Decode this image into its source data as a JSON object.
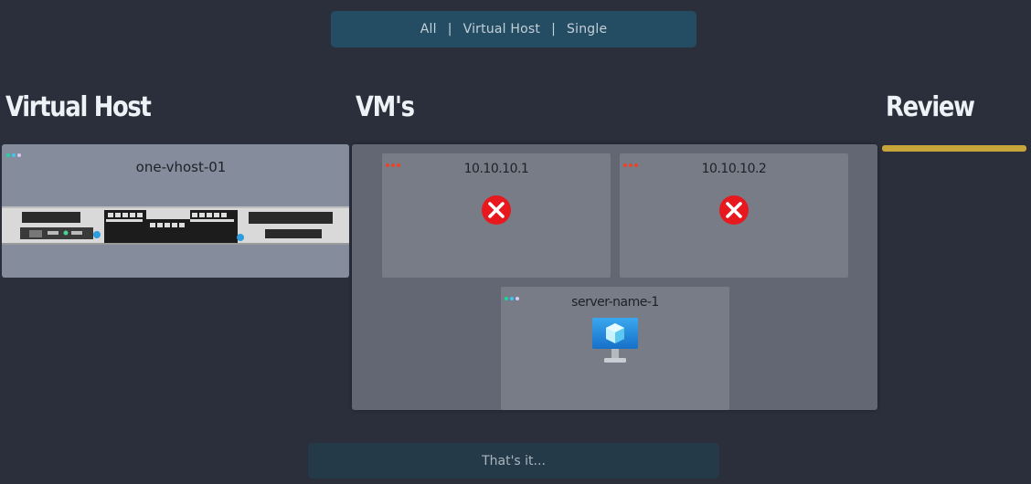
{
  "filter": {
    "options": [
      "All",
      "Virtual Host",
      "Single"
    ],
    "separator": "|"
  },
  "sections": {
    "virtual_host": "Virtual Host",
    "vms": "VM's",
    "review": "Review"
  },
  "host": {
    "name": "one-vhost-01",
    "icon": "rack-server-icon"
  },
  "vms": [
    {
      "label": "10.10.10.1",
      "status": "error",
      "icon": "error-x-icon"
    },
    {
      "label": "10.10.10.2",
      "status": "error",
      "icon": "error-x-icon"
    },
    {
      "label": "server-name-1",
      "status": "ok",
      "icon": "virtual-machine-icon"
    }
  ],
  "footer": {
    "label": "That's it..."
  },
  "colors": {
    "background": "#2a2f3b",
    "filter_bar": "#244c63",
    "review_accent": "#c8a53a",
    "error": "#e8181f",
    "vm_blue": "#1e90e0"
  }
}
